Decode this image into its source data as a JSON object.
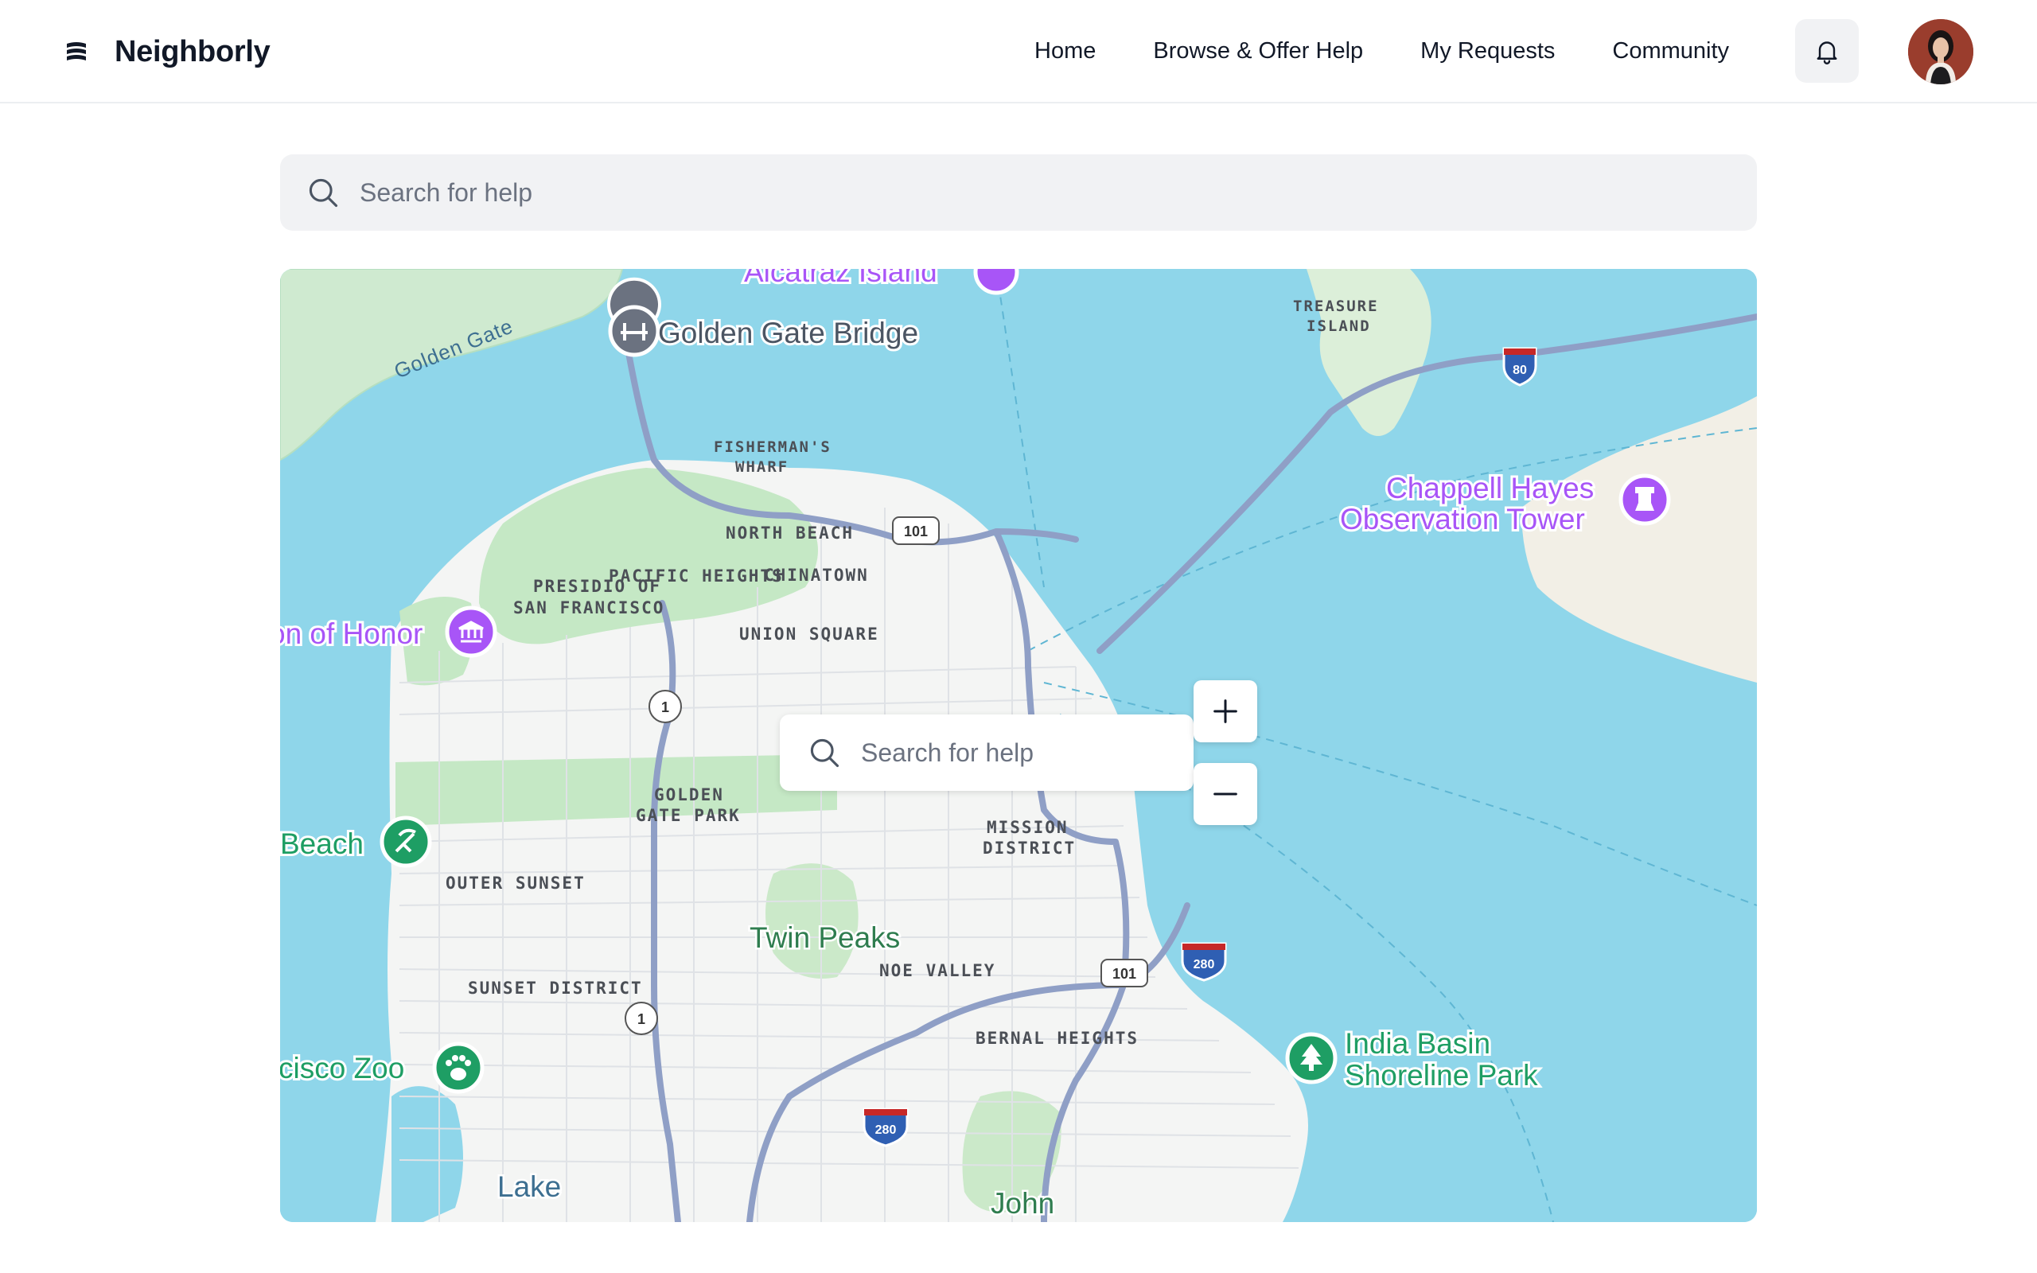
{
  "header": {
    "brand": "Neighborly",
    "nav": [
      "Home",
      "Browse & Offer Help",
      "My Requests",
      "Community"
    ]
  },
  "search": {
    "placeholder": "Search for help"
  },
  "map": {
    "search_placeholder": "Search for help",
    "zoom_in": "+",
    "zoom_out": "−",
    "labels": {
      "golden_gate": "Golden Gate",
      "fishermans_wharf_1": "FISHERMAN'S",
      "fishermans_wharf_2": "WHARF",
      "treasure_1": "TREASURE",
      "treasure_2": "ISLAND",
      "north_beach": "NORTH BEACH",
      "pacific_heights": "PACIFIC HEIGHTS",
      "chinatown": "CHINATOWN",
      "presidio_1": "PRESIDIO OF",
      "presidio_2": "SAN FRANCISCO",
      "union_square": "UNION SQUARE",
      "golden_gate_park_1": "GOLDEN",
      "golden_gate_park_2": "GATE PARK",
      "mission_1": "MISSION",
      "mission_2": "DISTRICT",
      "outer_sunset": "OUTER SUNSET",
      "twin_peaks": "Twin Peaks",
      "noe_valley": "NOE VALLEY",
      "sunset_district": "SUNSET DISTRICT",
      "bernal_heights": "BERNAL HEIGHTS",
      "lake": "Lake",
      "john": "John"
    },
    "pois": {
      "alcatraz": "Alcatraz Island",
      "golden_gate_bridge": "Golden Gate Bridge",
      "chappell_1": "Chappell Hayes",
      "chappell_2": "Observation Tower",
      "legion": "on of Honor",
      "beach": "Beach",
      "zoo": "cisco Zoo",
      "india_1": "India Basin",
      "india_2": "Shoreline Park"
    },
    "shields": {
      "i80": "80",
      "us101_north": "101",
      "sr1_north": "1",
      "sr1_south": "1",
      "us101_south": "101",
      "i280_east": "280",
      "i280_south": "280"
    },
    "colors": {
      "water": "#8fd6ea",
      "land": "#f4f5f4",
      "park": "#c5e8c5",
      "highway": "#8f9fc6",
      "attraction": "#a855f7",
      "nature": "#1e9e64"
    }
  }
}
